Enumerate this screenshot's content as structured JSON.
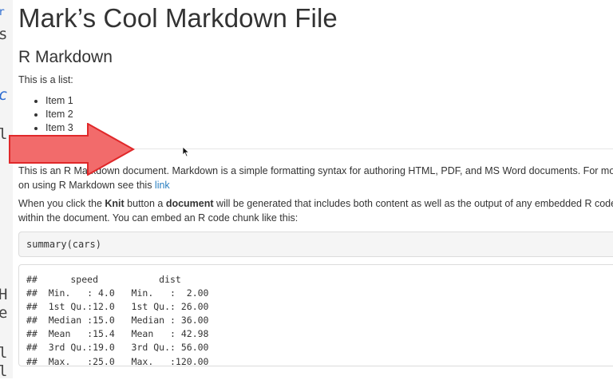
{
  "editor": {
    "glyphs": [
      "r",
      "s",
      "c",
      "l",
      "H",
      "e",
      "l",
      "l"
    ]
  },
  "doc": {
    "title": "Mark’s Cool Markdown File",
    "heading": "R Markdown",
    "intro": "This is a list:",
    "list_items": [
      "Item 1",
      "Item 2",
      "Item 3"
    ],
    "para1_line1": "This is an R Markdown document. Markdown is a simple formatting syntax for authoring HTML, PDF, and MS Word documents. For more d",
    "para1_line2_prefix": "on using R Markdown see this ",
    "para1_link": "link",
    "para2_part1": "When you click the ",
    "para2_bold1": "Knit",
    "para2_part2": " button a ",
    "para2_bold2": "document",
    "para2_part3": " will be generated that includes both content as well as the output of any embedded R code ch",
    "para2_line2": "within the document. You can embed an R code chunk like this:",
    "code": "summary(cars)",
    "output_lines": [
      "##      speed           dist       ",
      "##  Min.   : 4.0   Min.   :  2.00  ",
      "##  1st Qu.:12.0   1st Qu.: 26.00  ",
      "##  Median :15.0   Median : 36.00  ",
      "##  Mean   :15.4   Mean   : 42.98  ",
      "##  3rd Qu.:19.0   3rd Qu.: 56.00  ",
      "##  Max.   :25.0   Max.   :120.00  "
    ]
  },
  "colors": {
    "arrow_fill": "#f26b6b",
    "arrow_stroke": "#e0282a",
    "link": "#2a7fc1"
  }
}
